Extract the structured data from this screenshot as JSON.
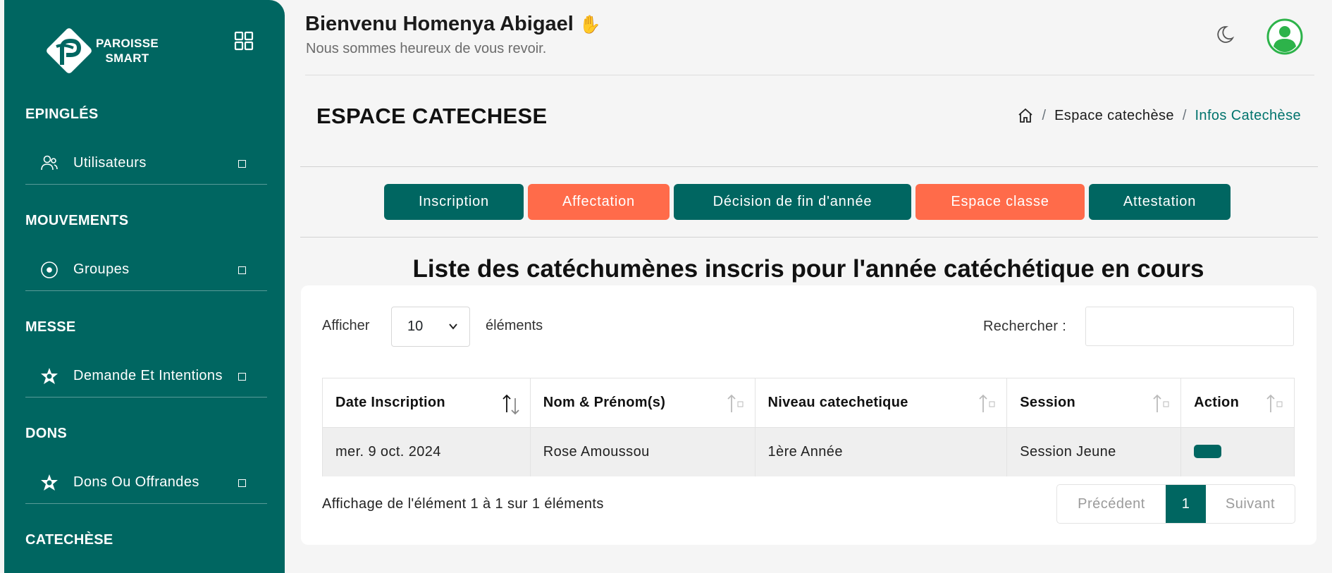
{
  "sidebar": {
    "logo_line1": "PAROISSE",
    "logo_line2": "SMART",
    "sections": [
      {
        "title": "EPINGLÉS",
        "item": {
          "label": "Utilisateurs",
          "icon": "users-icon"
        }
      },
      {
        "title": "MOUVEMENTS",
        "item": {
          "label": "Groupes",
          "icon": "circle-dot-icon"
        }
      },
      {
        "title": "MESSE",
        "item": {
          "label": "Demande Et Intentions",
          "icon": "star-badge-icon"
        }
      },
      {
        "title": "DONS",
        "item": {
          "label": "Dons Ou Offrandes",
          "icon": "star-badge-icon"
        }
      },
      {
        "title": "CATECHÈSE"
      }
    ]
  },
  "header": {
    "welcome": "Bienvenu Homenya Abigael",
    "wave": "✋",
    "subtitle": "Nous sommes heureux de vous revoir."
  },
  "page": {
    "title": "ESPACE CATECHESE",
    "breadcrumb": {
      "separator": "/",
      "crumb1": "Espace catechèse",
      "crumb2": "Infos Catechèse"
    }
  },
  "tabs": [
    {
      "label": "Inscription",
      "color": "#006661"
    },
    {
      "label": "Affectation",
      "color": "#ff6b4a"
    },
    {
      "label": "Décision de fin d'année",
      "color": "#006661"
    },
    {
      "label": "Espace classe",
      "color": "#ff6b4a"
    },
    {
      "label": "Attestation",
      "color": "#006661"
    }
  ],
  "list": {
    "title": "Liste des catéchumènes inscris pour l'année catéchétique en cours",
    "length_label": "Afficher",
    "length_value": "10",
    "length_after": "éléments",
    "search_label": "Rechercher :",
    "search_value": "",
    "columns": [
      "Date Inscription",
      "Nom & Prénom(s)",
      "Niveau catechetique",
      "Session",
      "Action"
    ],
    "rows": [
      {
        "date": "mer. 9 oct. 2024",
        "name": "Rose Amoussou",
        "level": "1ère Année",
        "session": "Session Jeune"
      }
    ],
    "info": "Affichage de l'élément 1 à 1 sur 1 éléments",
    "pager": {
      "prev": "Précédent",
      "current": "1",
      "next": "Suivant"
    }
  },
  "colors": {
    "primary": "#006661",
    "accent": "#ff6b4a",
    "avatar_green": "#2db34a"
  }
}
